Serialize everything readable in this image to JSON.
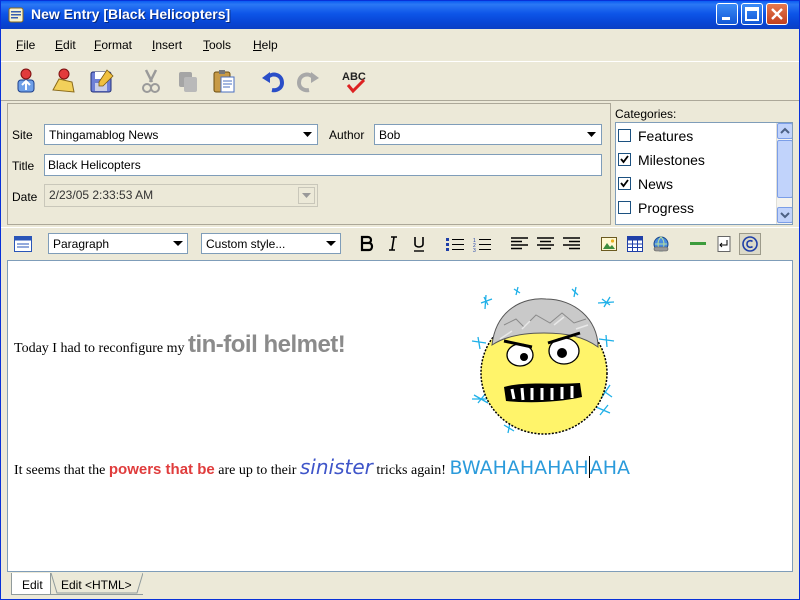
{
  "window": {
    "title": "New Entry [Black Helicopters]"
  },
  "menu": {
    "items": [
      {
        "label": "File",
        "u": "F",
        "rest": "ile"
      },
      {
        "label": "Edit",
        "u": "E",
        "rest": "dit"
      },
      {
        "label": "Format",
        "u": "F",
        "rest": "ormat"
      },
      {
        "label": "Insert",
        "u": "I",
        "rest": "nsert"
      },
      {
        "label": "Tools",
        "u": "T",
        "rest": "ools"
      },
      {
        "label": "Help",
        "u": "H",
        "rest": "elp"
      }
    ]
  },
  "form": {
    "site_label": "Site",
    "site_value": "Thingamablog News",
    "author_label": "Author",
    "author_value": "Bob",
    "title_label": "Title",
    "title_value": "Black Helicopters",
    "date_label": "Date",
    "date_value": "2/23/05 2:33:53 AM"
  },
  "categories": {
    "label": "Categories:",
    "items": [
      {
        "name": "Features",
        "checked": false
      },
      {
        "name": "Milestones",
        "checked": true
      },
      {
        "name": "News",
        "checked": true
      },
      {
        "name": "Progress",
        "checked": false
      }
    ]
  },
  "format": {
    "paragraph": "Paragraph",
    "style": "Custom style..."
  },
  "content": {
    "line1_plain": "Today I had to reconfigure my ",
    "line1_big": "tin-foil helmet!",
    "line2_a": "It seems that the ",
    "line2_powers": "powers that be",
    "line2_b": " are up to their ",
    "line2_sinister": "sinister",
    "line2_c": " tricks again! ",
    "line2_bwa1": "BWAHAHAHAH",
    "line2_bwa2": "AHA"
  },
  "tabs": {
    "edit": "Edit",
    "edit_html": "Edit <HTML>"
  },
  "colors": {
    "title_blue": "#0a5cf2",
    "red_text": "#e03c3c",
    "sinister": "#3f55c9",
    "bwa": "#2b9bdb"
  }
}
